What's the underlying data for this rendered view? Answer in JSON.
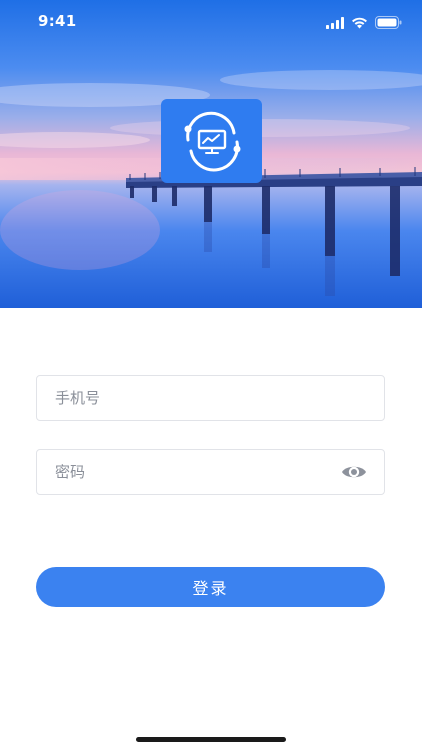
{
  "status_bar": {
    "time": "9:41",
    "icons": [
      "cellular-signal-icon",
      "wifi-icon",
      "battery-icon"
    ]
  },
  "hero": {
    "background": "sea-pier-at-dusk",
    "logo_icon": "sync-chart-monitor-icon",
    "logo_color": "#2f7cf0"
  },
  "login_form": {
    "phone_placeholder": "手机号",
    "password_placeholder": "密码",
    "password_toggle_icon": "eye-icon",
    "submit_label": "登录"
  },
  "theme": {
    "accent": "#3b82f0",
    "field_border": "#e1e3e8",
    "placeholder": "#8a8f99"
  }
}
